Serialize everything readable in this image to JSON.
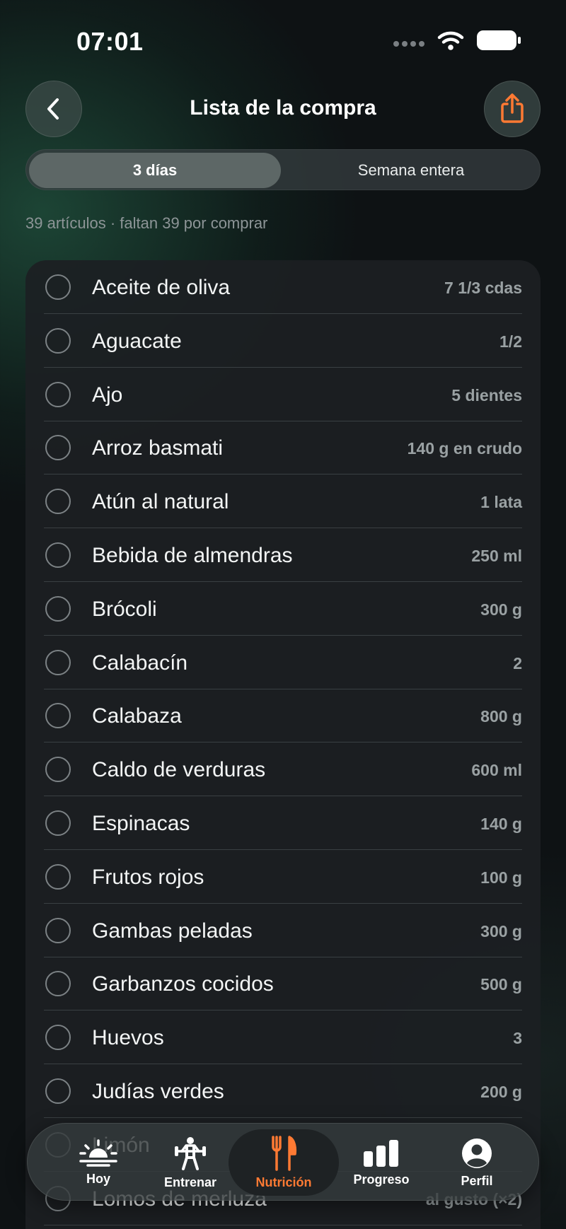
{
  "status_bar": {
    "time": "07:01"
  },
  "header": {
    "title": "Lista de la compra"
  },
  "segments": {
    "left": "3 días",
    "right": "Semana entera",
    "selected": "3 días"
  },
  "summary": "39 artículos · faltan 39 por comprar",
  "items": [
    {
      "name": "Aceite de oliva",
      "qty": "7 1/3 cdas"
    },
    {
      "name": "Aguacate",
      "qty": "1/2"
    },
    {
      "name": "Ajo",
      "qty": "5 dientes"
    },
    {
      "name": "Arroz basmati",
      "qty": "140 g en crudo"
    },
    {
      "name": "Atún al natural",
      "qty": "1 lata"
    },
    {
      "name": "Bebida de almendras",
      "qty": "250 ml"
    },
    {
      "name": "Brócoli",
      "qty": "300 g"
    },
    {
      "name": "Calabacín",
      "qty": "2"
    },
    {
      "name": "Calabaza",
      "qty": "800 g"
    },
    {
      "name": "Caldo de verduras",
      "qty": "600 ml"
    },
    {
      "name": "Espinacas",
      "qty": "140 g"
    },
    {
      "name": "Frutos rojos",
      "qty": "100 g"
    },
    {
      "name": "Gambas peladas",
      "qty": "300 g"
    },
    {
      "name": "Garbanzos cocidos",
      "qty": "500 g"
    },
    {
      "name": "Huevos",
      "qty": "3"
    },
    {
      "name": "Judías verdes",
      "qty": "200 g"
    },
    {
      "name": "Limón",
      "qty": ""
    },
    {
      "name": "Lomos de merluza",
      "qty": "al gusto (×2)"
    }
  ],
  "tabs": [
    {
      "label": "Hoy",
      "icon": "sunrise-icon"
    },
    {
      "label": "Entrenar",
      "icon": "weightlifter-icon"
    },
    {
      "label": "Nutrición",
      "icon": "fork-knife-icon",
      "active": true
    },
    {
      "label": "Progreso",
      "icon": "bar-chart-icon"
    },
    {
      "label": "Perfil",
      "icon": "person-circle-icon"
    }
  ],
  "colors": {
    "accent": "#ff7a33",
    "background": "#0e1214",
    "card": "#1c2023"
  }
}
